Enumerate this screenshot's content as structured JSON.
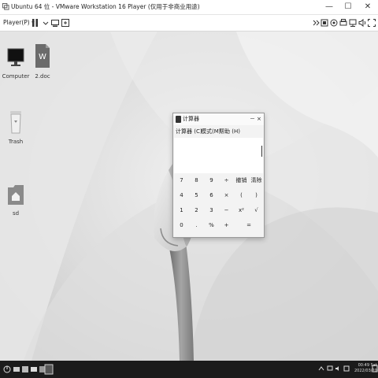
{
  "window": {
    "title": "Ubuntu 64 位 - VMware Workstation 16 Player (仅用于非商业用途)",
    "minimize_glyph": "—",
    "maximize_glyph": "☐",
    "close_glyph": "✕"
  },
  "toolbar": {
    "player_menu": "Player(P) ▾",
    "icons_left": [
      "pause-icon",
      "send-ctrl-alt-del-icon",
      "snapshot-icon"
    ],
    "icons_right": [
      "unity-icon",
      "removable-device-icon",
      "usb-icon",
      "printer-icon",
      "network-icon",
      "sound-icon",
      "fullscreen-icon",
      "settings-icon"
    ]
  },
  "desktop": {
    "icons": [
      {
        "label": "Computer",
        "icon": "monitor-icon"
      },
      {
        "label": "2.doc",
        "icon": "doc-icon"
      },
      {
        "label": "Trash",
        "icon": "trash-icon"
      },
      {
        "label": "sd",
        "icon": "home-folder-icon"
      }
    ]
  },
  "calculator": {
    "title": "计算器",
    "minimize": "－",
    "close": "×",
    "menu": [
      "计算器 (C)",
      "模式(M)",
      "帮助 (H)"
    ],
    "display_value": "",
    "keys": [
      [
        "7",
        "8",
        "9",
        "÷",
        "撤销",
        "清除"
      ],
      [
        "4",
        "5",
        "6",
        "×",
        "(",
        ")"
      ],
      [
        "1",
        "2",
        "3",
        "−",
        "x²",
        "√"
      ],
      [
        "0",
        ".",
        "%",
        "+",
        "="
      ]
    ]
  },
  "taskbar": {
    "time": "00:49 Sat",
    "date": "2022/03/20"
  },
  "colors": {
    "taskbar": "#1b1b1b",
    "wallpaper_base": "#d9d9d9"
  }
}
